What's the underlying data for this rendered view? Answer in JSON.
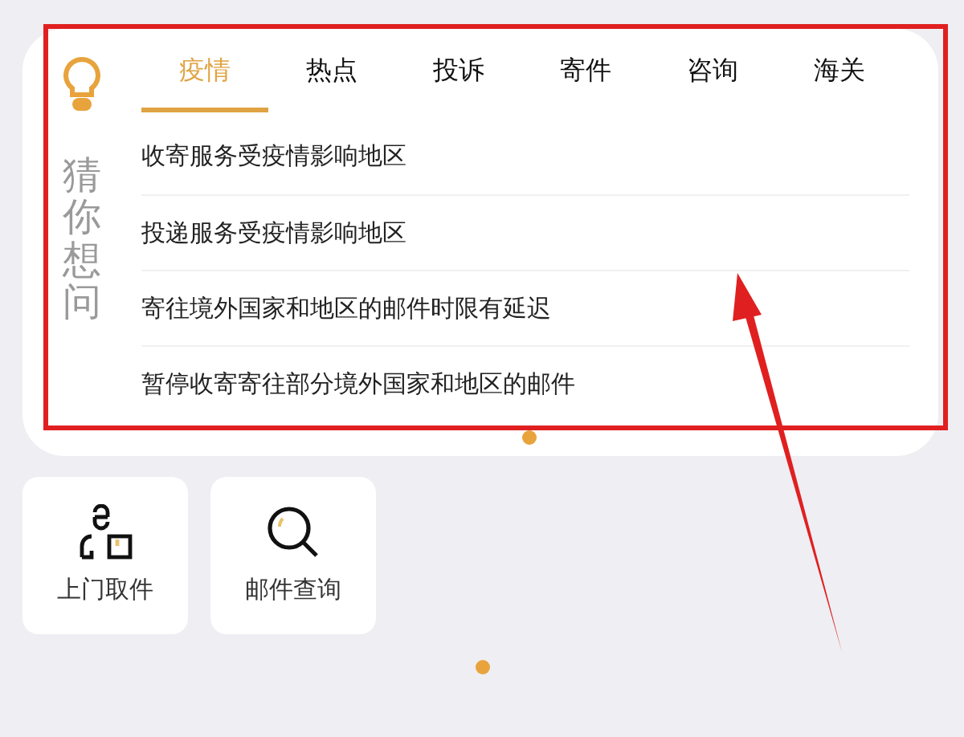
{
  "guess_panel": {
    "title": "猜你想问",
    "tabs": [
      {
        "label": "疫情",
        "selected": true
      },
      {
        "label": "热点",
        "selected": false
      },
      {
        "label": "投诉",
        "selected": false
      },
      {
        "label": "寄件",
        "selected": false
      },
      {
        "label": "咨询",
        "selected": false
      },
      {
        "label": "海关",
        "selected": false
      }
    ],
    "questions": [
      "收寄服务受疫情影响地区",
      "投递服务受疫情影响地区",
      "寄往境外国家和地区的邮件时限有延迟",
      "暂停收寄寄往部分境外国家和地区的邮件"
    ]
  },
  "services": [
    {
      "kind": "pickup",
      "label": "上门取件"
    },
    {
      "kind": "tracking",
      "label": "邮件查询"
    }
  ]
}
